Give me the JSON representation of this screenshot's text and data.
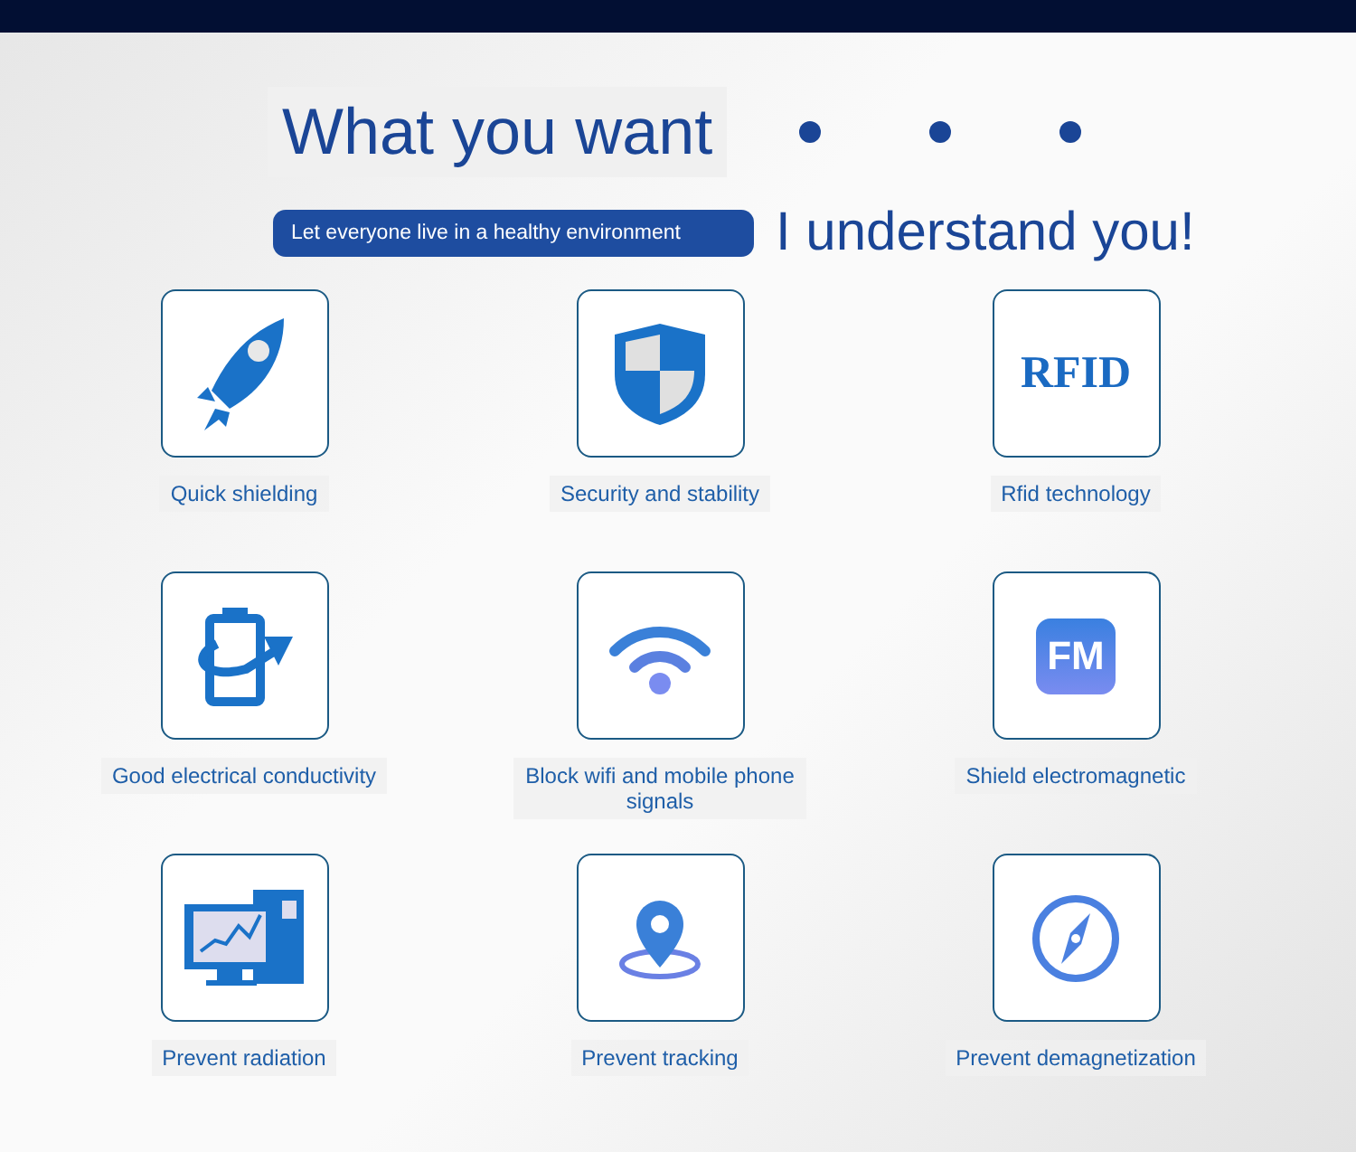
{
  "heading": {
    "title": "What you want",
    "tagline": "Let everyone live in a healthy environment",
    "subtitle": "I understand you!"
  },
  "features": [
    {
      "kind": "rocket",
      "label": "Quick shielding"
    },
    {
      "kind": "shield",
      "label": "Security and stability"
    },
    {
      "kind": "rfid",
      "icon_text": "RFID",
      "label": "Rfid technology"
    },
    {
      "kind": "clipboard",
      "label": "Good electrical conductivity"
    },
    {
      "kind": "wifi",
      "label": "Block wifi and mobile phone signals"
    },
    {
      "kind": "fm",
      "icon_text": "FM",
      "label": "Shield electromagnetic"
    },
    {
      "kind": "monitor",
      "label": "Prevent radiation"
    },
    {
      "kind": "pin",
      "label": "Prevent tracking"
    },
    {
      "kind": "compass",
      "label": "Prevent demagnetization"
    }
  ]
}
